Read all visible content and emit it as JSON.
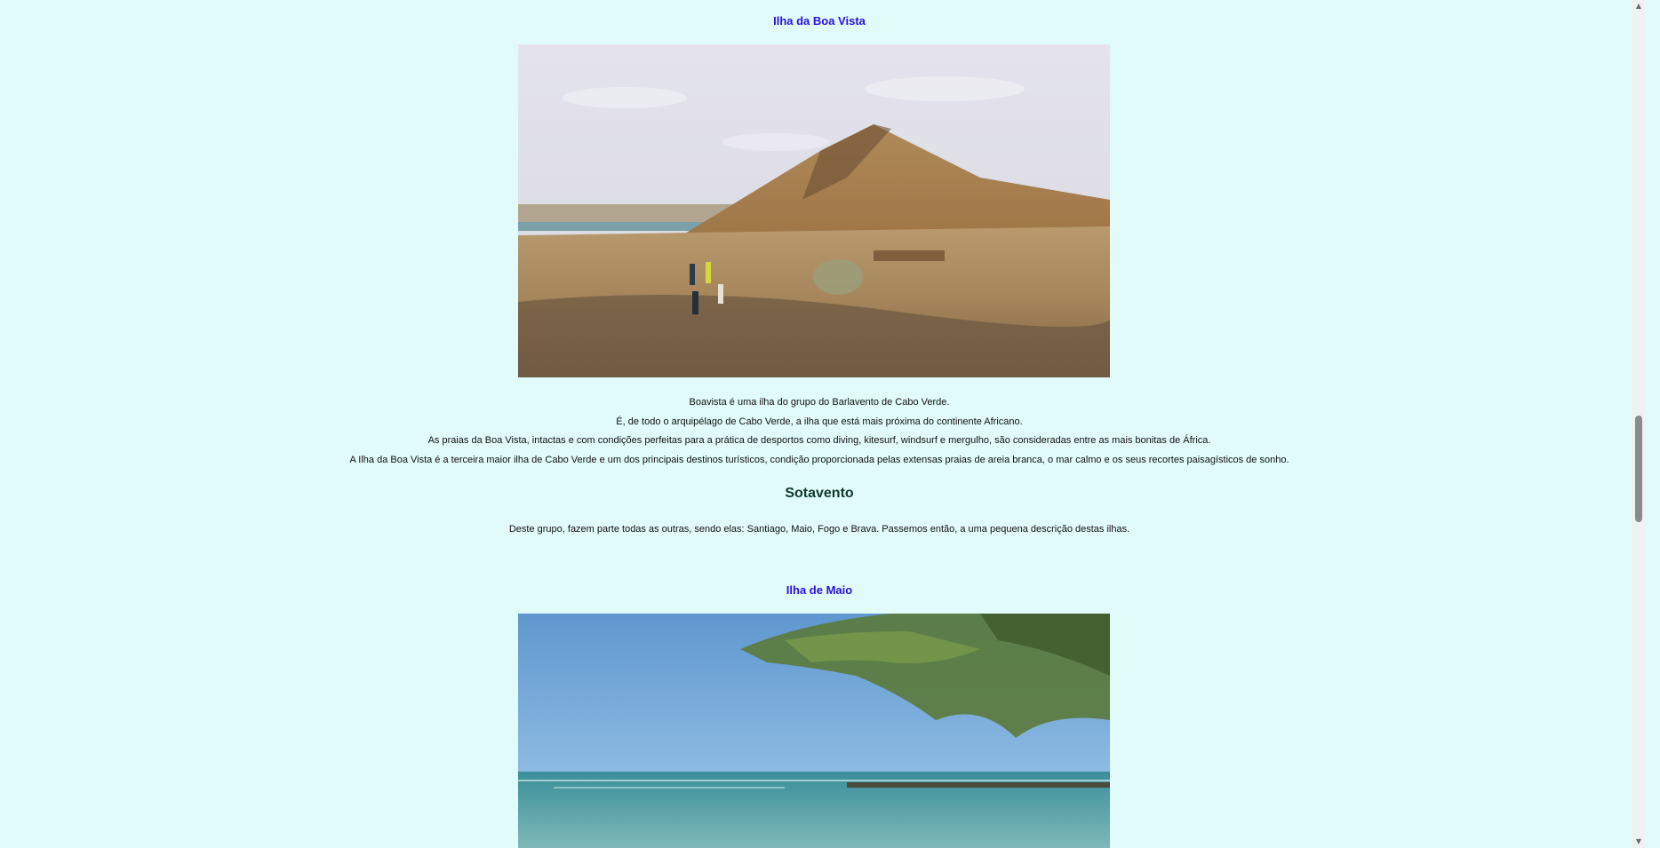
{
  "boavista": {
    "title": "Ilha da Boa Vista",
    "paragraphs": [
      "Boavista é uma ilha do grupo do Barlavento de Cabo Verde.",
      "É, de todo o arquipélago de Cabo Verde, a ilha que está mais próxima do continente Africano.",
      "As praias da Boa Vista, intactas e com condições perfeitas para a prática de desportos como diving, kitesurf, windsurf e mergulho, são consideradas entre as mais bonitas de África.",
      "A Ilha da Boa Vista é a terceira maior ilha de Cabo Verde e um dos principais destinos turísticos, condição proporcionada pelas extensas praias de areia branca, o mar calmo e os seus recortes paisagísticos de sonho."
    ]
  },
  "sotavento": {
    "heading": "Sotavento",
    "text": "Deste grupo, fazem parte todas as outras, sendo elas: Santiago, Maio, Fogo e Brava. Passemos então, a uma pequena descrição destas ilhas."
  },
  "maio": {
    "title": "Ilha de Maio"
  },
  "scrollbar": {
    "up_icon": "scroll-up-arrow",
    "down_icon": "scroll-down-arrow"
  }
}
